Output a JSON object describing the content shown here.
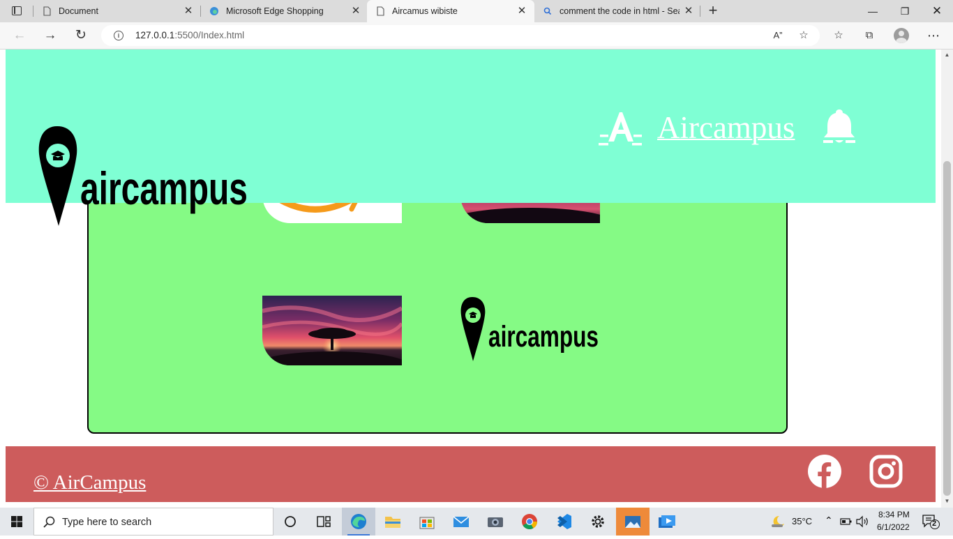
{
  "browser": {
    "tabs": [
      {
        "label": "Document",
        "icon": "page-icon",
        "active": false
      },
      {
        "label": "Microsoft Edge Shopping",
        "icon": "edge-icon",
        "active": false
      },
      {
        "label": "Aircamus wibiste",
        "icon": "page-icon",
        "active": true
      },
      {
        "label": "comment the code in html - Sea",
        "icon": "search-icon",
        "active": false
      }
    ],
    "url_host": "127.0.0.1",
    "url_path": ":5500/Index.html",
    "window_controls": [
      "minimize",
      "restore",
      "close"
    ]
  },
  "page": {
    "header": {
      "logo_text": "aircampus",
      "brand_link": "Aircampus",
      "brand_icon": "ai-letter-icon",
      "bell_icon": "bell-icon",
      "background": "#7fffd4"
    },
    "gallery": {
      "background": "#85fa85",
      "items": [
        {
          "name": "amazon-logo-image"
        },
        {
          "name": "sunset-tree-image"
        },
        {
          "name": "sunset-tree-image"
        },
        {
          "name": "aircampus-logo-image",
          "text": "aircampus"
        }
      ]
    },
    "footer": {
      "copyright": "© AirCampus",
      "background": "#cd5c5c",
      "social": [
        "facebook-icon",
        "instagram-icon"
      ]
    }
  },
  "taskbar": {
    "search_placeholder": "Type here to search",
    "weather": "35°C",
    "time": "8:34 PM",
    "date": "6/1/2022",
    "notifications": "2"
  }
}
